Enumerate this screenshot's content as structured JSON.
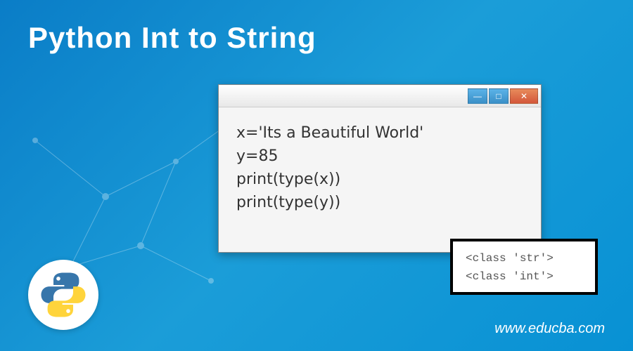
{
  "title": "Python Int to String",
  "code": {
    "line1": "x='Its a Beautiful World'",
    "line2": "y=85",
    "line3": "print(type(x))",
    "line4": "print(type(y))"
  },
  "output": {
    "line1": "<class 'str'>",
    "line2": "<class 'int'>"
  },
  "window_controls": {
    "minimize": "—",
    "maximize": "□",
    "close": "✕"
  },
  "footer": "www.educba.com"
}
